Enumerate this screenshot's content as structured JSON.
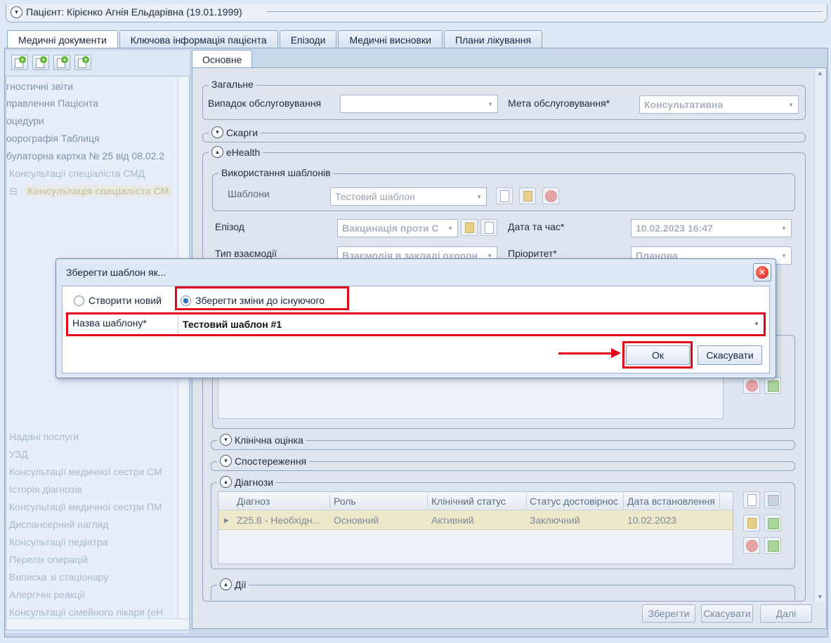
{
  "patient": {
    "title": "Пацієнт: Кірієнко Агнія Ельдарівна (19.01.1999)"
  },
  "main_tabs": [
    {
      "label": "Медичні документи",
      "active": true
    },
    {
      "label": "Ключова інформація пацієнта",
      "active": false
    },
    {
      "label": "Епізоди",
      "active": false
    },
    {
      "label": "Медичні висновки",
      "active": false
    },
    {
      "label": "Плани лікування",
      "active": false
    }
  ],
  "sidebar": {
    "toolbar_icons": [
      "add-document-icon",
      "add-record-icon",
      "add-copy-icon",
      "add-item-icon"
    ],
    "items": [
      "гностичні звіти",
      "правлення Пацієнта",
      "оцедури",
      "оорографія Таблиця",
      "булаторна картка № 25 від 08.02.2",
      "Консультації спеціаліста СМД",
      "Консультація спеціаліста СМ",
      "Надані послуги",
      "УЗД",
      "Консультації медичної сестри СМ",
      "Історія діагнозів",
      "Консультації медичної сестри ПМ",
      "Диспансерний нагляд",
      "Консультації педіатра",
      "Перелік операцій",
      "Виписка зі стаціонару",
      "Алергічні реакції",
      "Консультації сімейного лікаря (еН"
    ]
  },
  "content": {
    "tab": "Основне",
    "general": {
      "legend": "Загальне",
      "case_label": "Випадок обслуговування",
      "case_value": "",
      "goal_label": "Мета обслуговування*",
      "goal_value": "Консультативна"
    },
    "complaints": {
      "legend": "Скарги"
    },
    "ehealth": {
      "legend": "eHealth",
      "templates_legend": "Використання шаблонів",
      "templates_label": "Шаблони",
      "templates_value": "Тестовий шаблон",
      "episode_label": "Епізод",
      "episode_value": "Вакцинація проти С",
      "datetime_label": "Дата та час*",
      "datetime_value": "10.02.2023 16:47",
      "interaction_label": "Тип взаємодії",
      "interaction_value": "Взаємодія в закладі охорон",
      "priority_label": "Пріоритет*",
      "priority_value": "Планова"
    },
    "clinical": {
      "legend": "Клінічна оцінка"
    },
    "observations": {
      "legend": "Спостереження"
    },
    "diagnoses": {
      "legend": "Діагнози",
      "columns": [
        "Діагноз",
        "Роль",
        "Клінічний статус",
        "Статус достовірнос",
        "Дата встановлення"
      ],
      "rows": [
        [
          "Z25.8 - Необхідн...",
          "Основний",
          "Активний",
          "Заключний",
          "10.02.2023"
        ]
      ]
    },
    "actions": {
      "legend": "Дії"
    }
  },
  "footer_buttons": {
    "save": "Зберегти",
    "cancel": "Скасувати",
    "next": "Далі"
  },
  "dialog": {
    "title": "Зберегти шаблон як...",
    "option_new": "Створити новий",
    "option_existing": "Зберегти зміни до існуючого",
    "selected_option": "option_existing",
    "name_label": "Назва шаблону*",
    "name_value": "Тестовий шаблон #1",
    "ok": "Ок",
    "cancel": "Скасувати"
  },
  "colors": {
    "highlight_red": "#e5001a",
    "accent_blue": "#2a6ab9"
  }
}
